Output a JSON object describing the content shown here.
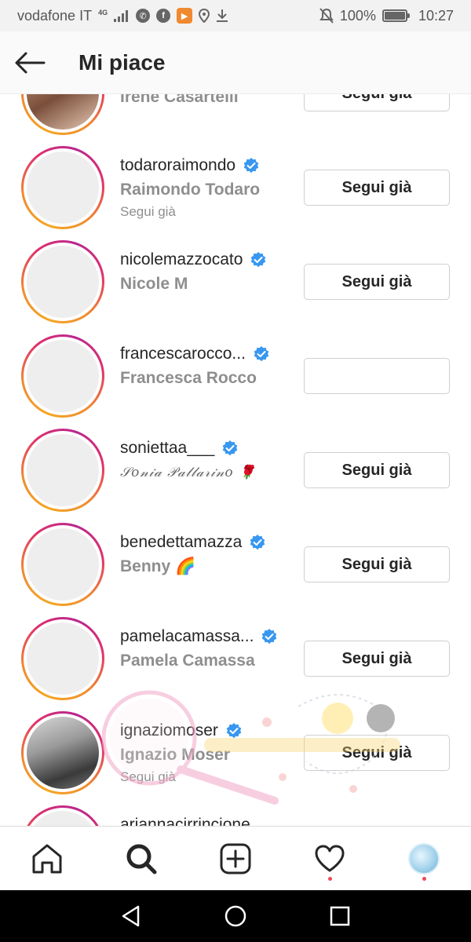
{
  "status_bar": {
    "carrier": "vodafone IT",
    "network": "4G",
    "battery": "100%",
    "battery_level": 1.0,
    "time": "10:27"
  },
  "header": {
    "title": "Mi piace"
  },
  "users": [
    {
      "username": "",
      "full_name": "Irene Casartelli",
      "verified": false,
      "followed_text": "",
      "button": "Segui già"
    },
    {
      "username": "todaroraimondo",
      "full_name": "Raimondo Todaro",
      "verified": true,
      "followed_text": "Segui già",
      "button": "Segui già"
    },
    {
      "username": "nicolemazzocato",
      "full_name": "Nicole M",
      "verified": true,
      "followed_text": "",
      "button": "Segui già"
    },
    {
      "username": "francescarocco...",
      "full_name": "Francesca Rocco",
      "verified": true,
      "followed_text": "",
      "button": ""
    },
    {
      "username": "soniettaa___",
      "full_name": "𝒮𝑜𝓃𝒾𝒶 𝒫𝒶𝓁𝓁𝒶𝓇𝒾𝓃𝑜 🌹",
      "verified": true,
      "followed_text": "",
      "button": "Segui già"
    },
    {
      "username": "benedettamazza",
      "full_name": "Benny 🌈",
      "verified": true,
      "followed_text": "",
      "button": "Segui già"
    },
    {
      "username": "pamelacamassa...",
      "full_name": "Pamela Camassa",
      "verified": true,
      "followed_text": "",
      "button": "Segui già"
    },
    {
      "username": "ignaziomoser",
      "full_name": "Ignazio Moser",
      "verified": true,
      "followed_text": "Segui già",
      "button": "Segui già"
    },
    {
      "username": "ariannacirrincione",
      "full_name": "",
      "verified": false,
      "followed_text": "",
      "button": ""
    }
  ],
  "bottom_nav": {
    "items": [
      "home-icon",
      "search-icon",
      "new-post-icon",
      "activity-heart-icon",
      "profile-avatar"
    ]
  },
  "colors": {
    "verified_blue": "#3897f0",
    "ring_orange": "#f5a623",
    "ring_magenta": "#b9268f",
    "notification_red": "#ed4956"
  }
}
